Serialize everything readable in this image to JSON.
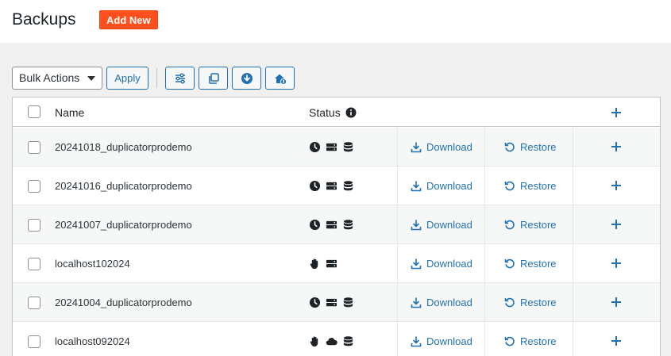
{
  "header": {
    "title": "Backups",
    "add_new_label": "Add New"
  },
  "toolbar": {
    "bulk_actions_value": "Bulk Actions",
    "apply_label": "Apply",
    "icon_buttons": [
      "filter-settings-icon",
      "copy-icon",
      "download-circle-icon",
      "house-lock-icon"
    ]
  },
  "table": {
    "columns": {
      "name": "Name",
      "status": "Status"
    },
    "download_label": "Download",
    "restore_label": "Restore",
    "rows": [
      {
        "name": "20241018_duplicatorprodemo",
        "status_icons": [
          "clock-icon",
          "server-icon",
          "database-icon"
        ]
      },
      {
        "name": "20241016_duplicatorprodemo",
        "status_icons": [
          "clock-icon",
          "server-icon",
          "database-icon"
        ]
      },
      {
        "name": "20241007_duplicatorprodemo",
        "status_icons": [
          "clock-icon",
          "server-icon",
          "database-icon"
        ]
      },
      {
        "name": "localhost102024",
        "status_icons": [
          "hand-icon",
          "server-icon"
        ]
      },
      {
        "name": "20241004_duplicatorprodemo",
        "status_icons": [
          "clock-icon",
          "server-icon",
          "database-icon"
        ]
      },
      {
        "name": "localhost092024",
        "status_icons": [
          "hand-icon",
          "cloud-icon",
          "database-icon"
        ]
      }
    ]
  },
  "colors": {
    "accent": "#2271b1",
    "brand": "#ff4f1d",
    "page_bg": "#f0f0f1"
  }
}
